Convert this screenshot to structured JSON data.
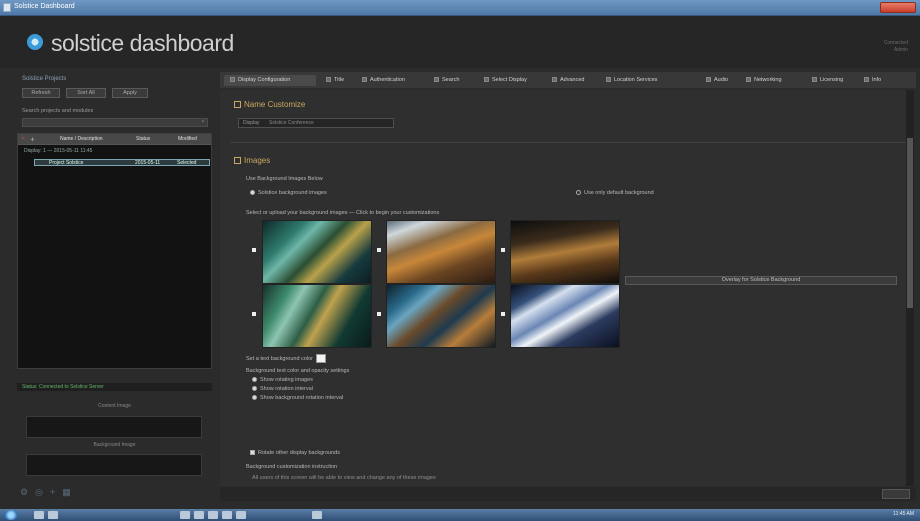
{
  "window": {
    "title": "Solstice Dashboard"
  },
  "header": {
    "brand": "solstice dashboard",
    "right_line1": "Connected",
    "right_line2": "Admin"
  },
  "left_panel": {
    "title": "Solstice Projects",
    "buttons": [
      "Refresh",
      "Sort All",
      "Apply"
    ],
    "subtitle": "Search projects and modules",
    "table_headers": [
      "Name / Description",
      "Status",
      "Modified"
    ],
    "group_label": "Display: 1 — 2015-05-11 11:45",
    "selected_row": {
      "name": "Project Solstice",
      "status": "2015-05-11",
      "modified": "Selected"
    },
    "status_text": "Status: Connected to Solstice Server",
    "box1_label": "Content Image",
    "box2_label": "Background Image"
  },
  "tabs": [
    "Display Configuration",
    "Title",
    "Authentication",
    "Search",
    "Select Display",
    "Advanced",
    "Location Services",
    "Audio",
    "Networking",
    "Licensing",
    "Info"
  ],
  "content": {
    "section1_title": "Name Customize",
    "name_label": "Display",
    "name_value": "Solstice Conference",
    "section2_title": "Images",
    "sub_heading": "Use Background Images Below",
    "radio_left": "Solstice background images",
    "radio_right": "Use only default background",
    "upload_label": "Select or upload your background images — Click to begin your customizations",
    "wide_button": "Overlay for Solstice Background",
    "color_label": "Set a text background color",
    "options_heading": "Background text color and opacity settings",
    "options": [
      "Show rotating images",
      "Show rotation interval",
      "Show background rotation interval"
    ],
    "checkbox_label": "Rotate other display backgrounds",
    "note_heading": "Background customization instruction",
    "note_text": "All users of this screen will be able to view and change any of these images"
  },
  "taskbar": {
    "clock": "11:45 AM"
  },
  "colors": {
    "accent": "#c8a860",
    "selected": "#7da6b0",
    "status_ok": "#64b86b"
  }
}
